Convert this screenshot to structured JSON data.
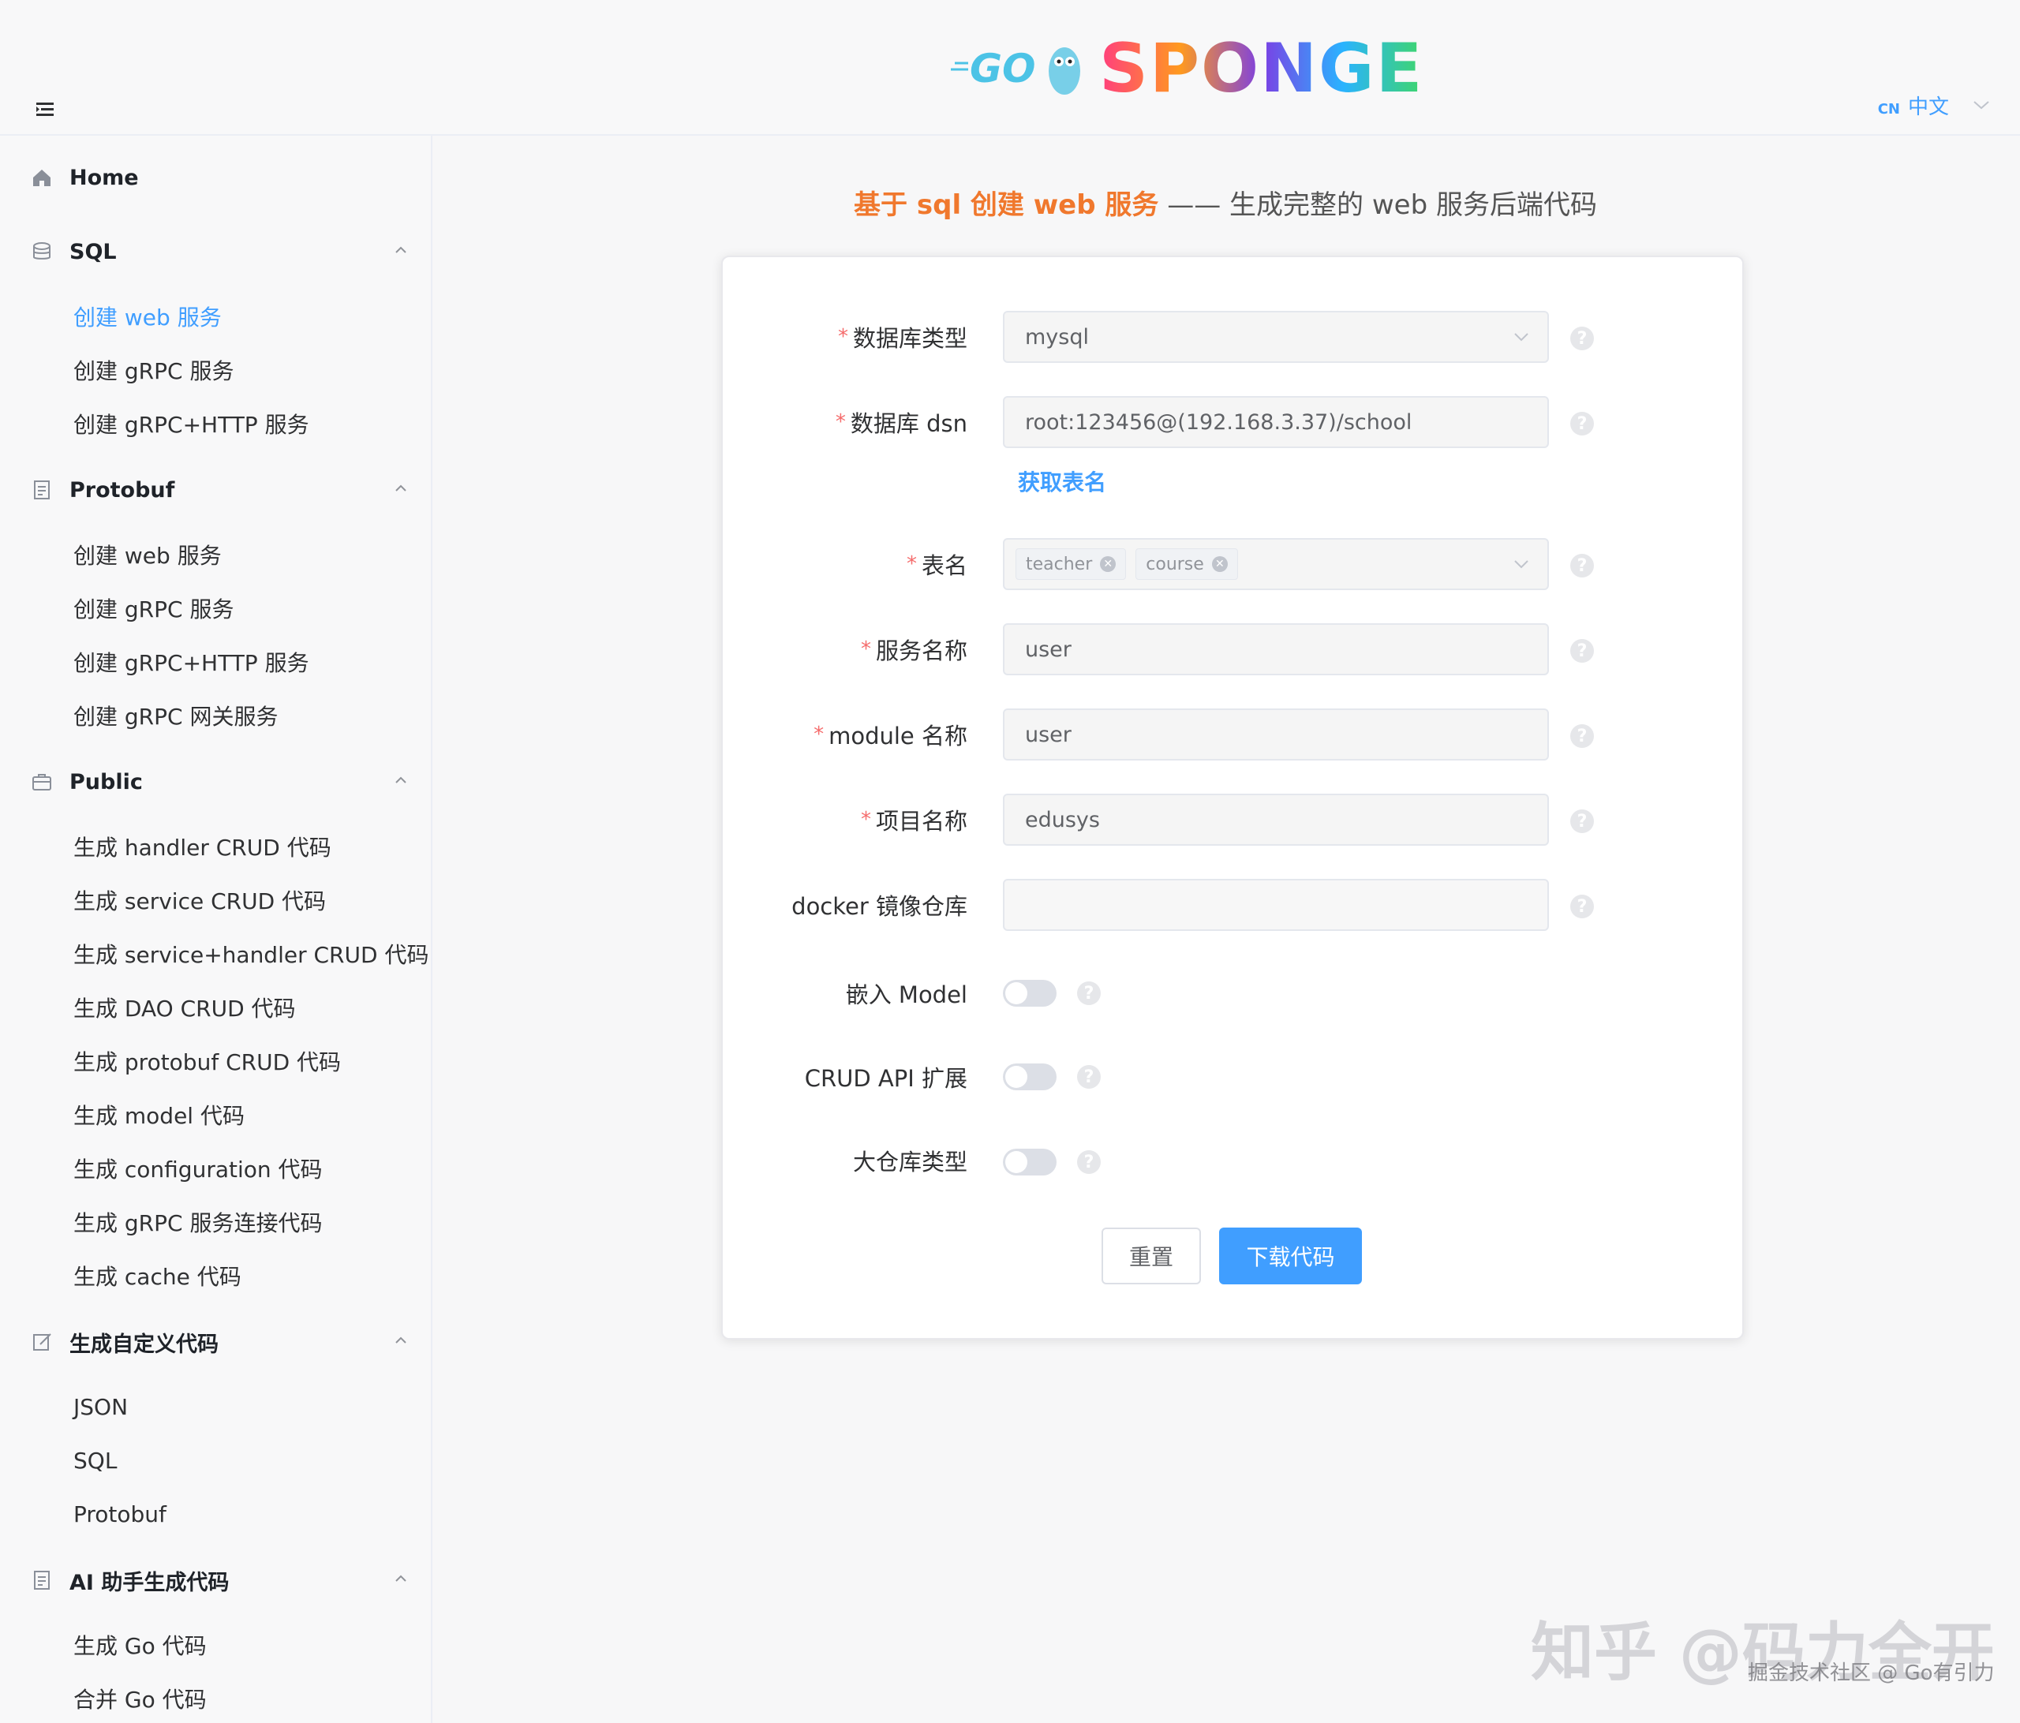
{
  "header": {
    "logo_text": "GO SPONGE",
    "lang_tag": "CN",
    "lang_label": "中文"
  },
  "sidebar": {
    "home_label": "Home",
    "groups": [
      {
        "title": "SQL",
        "items": [
          "创建 web 服务",
          "创建 gRPC 服务",
          "创建 gRPC+HTTP 服务"
        ]
      },
      {
        "title": "Protobuf",
        "items": [
          "创建 web 服务",
          "创建 gRPC 服务",
          "创建 gRPC+HTTP 服务",
          "创建 gRPC 网关服务"
        ]
      },
      {
        "title": "Public",
        "items": [
          "生成 handler CRUD 代码",
          "生成 service CRUD 代码",
          "生成 service+handler CRUD 代码",
          "生成 DAO CRUD 代码",
          "生成 protobuf CRUD 代码",
          "生成 model 代码",
          "生成 configuration 代码",
          "生成 gRPC 服务连接代码",
          "生成 cache 代码"
        ]
      },
      {
        "title": "生成自定义代码",
        "items": [
          "JSON",
          "SQL",
          "Protobuf"
        ]
      },
      {
        "title": "AI 助手生成代码",
        "items": [
          "生成 Go 代码",
          "合并 Go 代码"
        ]
      }
    ]
  },
  "main": {
    "title_accent": "基于 sql 创建 web 服务",
    "title_rest": " —— 生成完整的 web 服务后端代码",
    "form": {
      "db_type_label": "数据库类型",
      "db_type_value": "mysql",
      "dsn_label": "数据库 dsn",
      "dsn_value": "root:123456@(192.168.3.37)/school",
      "fetch_tables_label": "获取表名",
      "tables_label": "表名",
      "tables": [
        "teacher",
        "course"
      ],
      "service_name_label": "服务名称",
      "service_name_value": "user",
      "module_label": "module 名称",
      "module_value": "user",
      "project_label": "项目名称",
      "project_value": "edusys",
      "docker_label": "docker 镜像仓库",
      "docker_value": "",
      "embed_model_label": "嵌入 Model",
      "crud_ext_label": "CRUD API 扩展",
      "monorepo_label": "大仓库类型",
      "reset_label": "重置",
      "download_label": "下载代码",
      "help_glyph": "?"
    }
  },
  "watermark": {
    "main": "知乎 @码力全开",
    "sub": "掘金技术社区 @ Go有引力"
  },
  "colors": {
    "accent": "#409eff",
    "title_accent": "#f0782d",
    "required": "#f56c6c"
  }
}
